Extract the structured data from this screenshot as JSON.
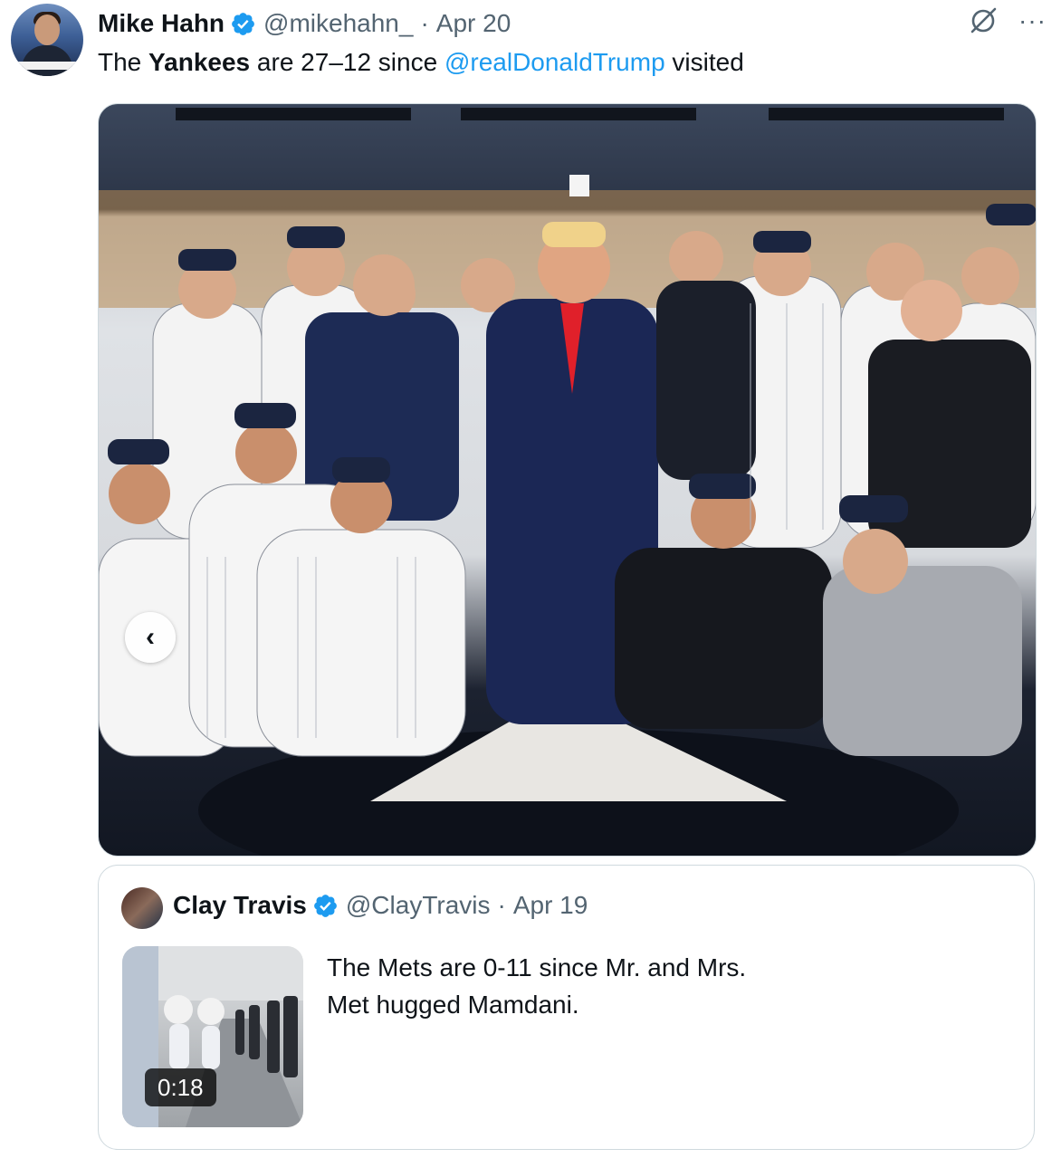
{
  "tweet": {
    "author_name": "Mike Hahn",
    "author_handle": "@mikehahn_",
    "separator": "·",
    "date": "Apr 20",
    "text_1": "The ",
    "text_bold": "Yankees",
    "text_2": " are 27–12 since ",
    "mention": "@realDonaldTrump",
    "text_3": " visited",
    "verified_icon": "verified-badge-icon",
    "more_label": "···",
    "media": {
      "carousel_prev_label": "‹"
    }
  },
  "quoted_tweet": {
    "author_name": "Clay Travis",
    "author_handle": "@ClayTravis",
    "separator": "·",
    "date": "Apr 19",
    "text": "The Mets are 0-11 since Mr. and Mrs. Met hugged Mamdani.",
    "video_duration": "0:18"
  },
  "colors": {
    "link": "#1d9bf0",
    "secondary_text": "#536471",
    "border": "#cfd9de"
  }
}
